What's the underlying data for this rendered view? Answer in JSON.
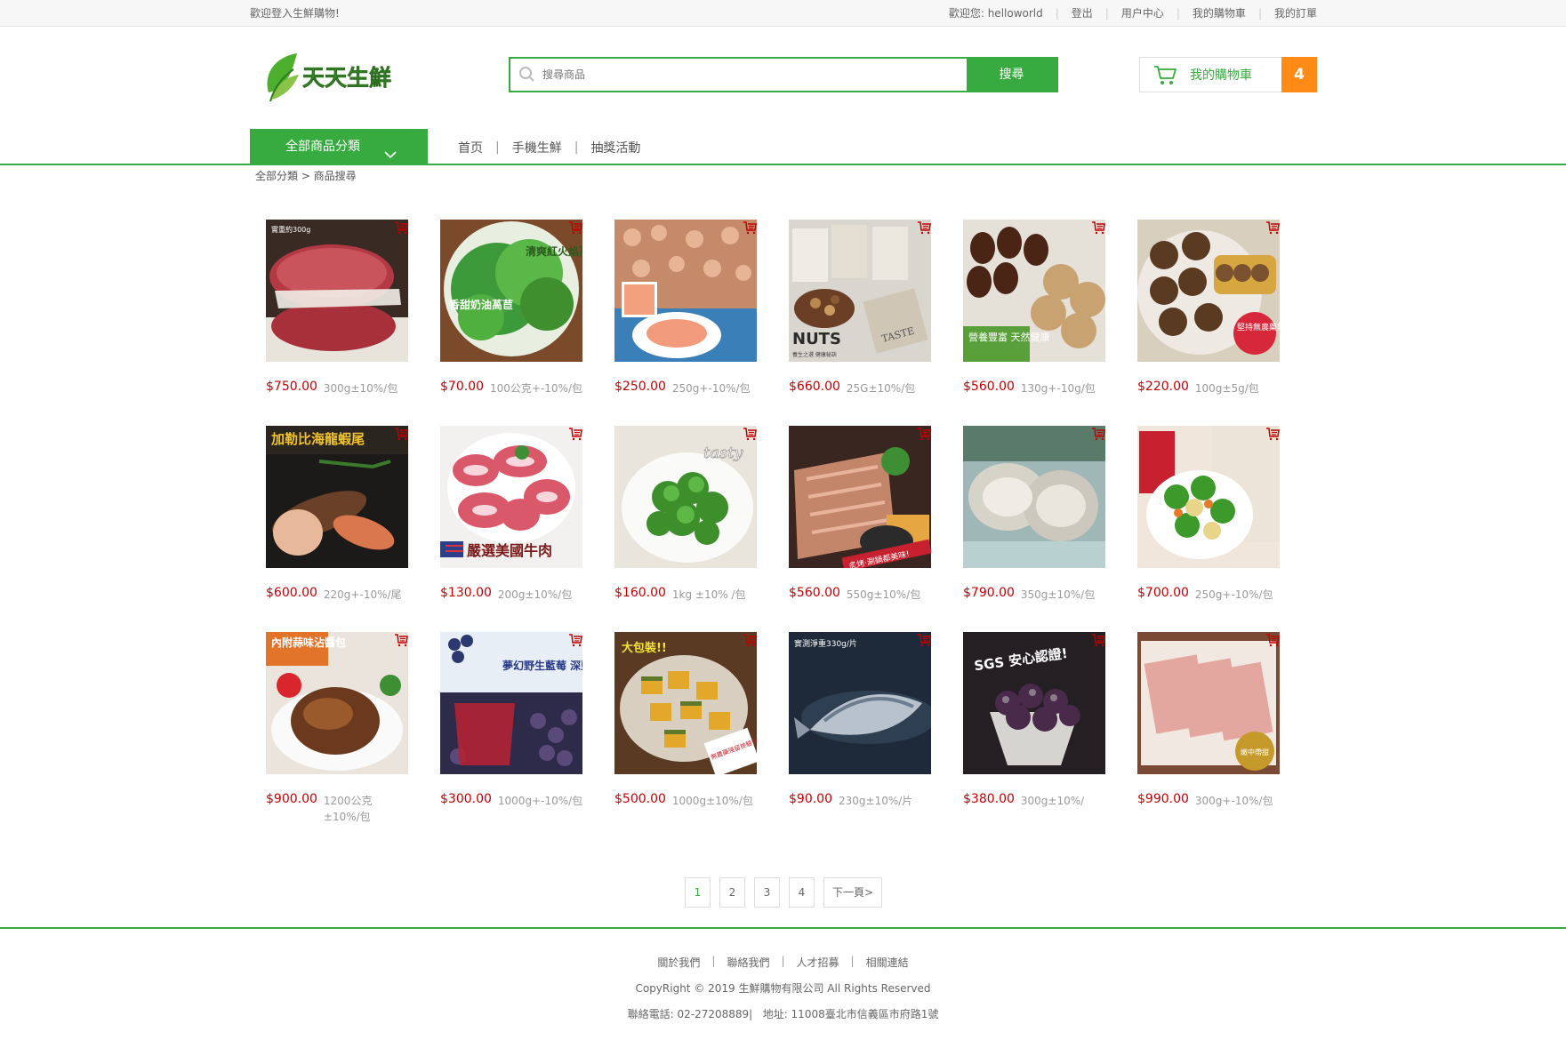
{
  "topbar": {
    "welcome": "歡迎登入生鮮購物!",
    "greeting": "歡迎您: helloworld",
    "logout": "登出",
    "user_center": "用户中心",
    "my_cart": "我的購物車",
    "my_orders": "我的訂單"
  },
  "header": {
    "logo_text": "天天生鮮",
    "search_placeholder": "搜尋商品",
    "search_button": "搜尋",
    "cart_label": "我的購物車",
    "cart_count": "4"
  },
  "nav": {
    "all_categories": "全部商品分類",
    "home": "首页",
    "mobile": "手機生鮮",
    "lottery": "抽獎活動"
  },
  "breadcrumb": "全部分類 > 商品搜尋",
  "products": [
    {
      "price": "$750.00",
      "unit": "300g±10%/包",
      "name": "beef-patty"
    },
    {
      "price": "$70.00",
      "unit": "100公克+-10%/包",
      "name": "lettuce"
    },
    {
      "price": "$250.00",
      "unit": "250g+-10%/包",
      "name": "shrimp"
    },
    {
      "price": "$660.00",
      "unit": "25G±10%/包",
      "name": "nuts"
    },
    {
      "price": "$560.00",
      "unit": "130g+-10g/包",
      "name": "dried-figs"
    },
    {
      "price": "$220.00",
      "unit": "100g±5g/包",
      "name": "shiitake"
    },
    {
      "price": "$600.00",
      "unit": "220g+-10%/尾",
      "name": "lobster"
    },
    {
      "price": "$130.00",
      "unit": "200g±10%/包",
      "name": "beef-slices"
    },
    {
      "price": "$160.00",
      "unit": "1kg ±10% /包",
      "name": "broccoli"
    },
    {
      "price": "$560.00",
      "unit": "550g±10%/包",
      "name": "pork-belly"
    },
    {
      "price": "$790.00",
      "unit": "350g±10%/包",
      "name": "oysters"
    },
    {
      "price": "$700.00",
      "unit": "250g+-10%/包",
      "name": "mixed-veg"
    },
    {
      "price": "$900.00",
      "unit": "1200公克±10%/包",
      "name": "pork-knuckle"
    },
    {
      "price": "$300.00",
      "unit": "1000g+-10%/包",
      "name": "blueberries"
    },
    {
      "price": "$500.00",
      "unit": "1000g±10%/包",
      "name": "pumpkin"
    },
    {
      "price": "$90.00",
      "unit": "230g±10%/片",
      "name": "mackerel"
    },
    {
      "price": "$380.00",
      "unit": "300g±10%/",
      "name": "mulberries"
    },
    {
      "price": "$990.00",
      "unit": "300g+-10%/包",
      "name": "pork-slices"
    }
  ],
  "badges": {
    "beef_top": "實重約300g",
    "lettuce_a": "清爽紅火焰萵苣",
    "lettuce_b": "香甜奶油萵苣",
    "nuts": "NUTS",
    "nuts_sub": "養生之選 健康秘訣",
    "nuts_taste": "TASTE",
    "figs": "營養豐富 天然健康",
    "shiitake": "堅持無農藥無添加",
    "lobster": "加勒比海龍蝦尾",
    "beef": "嚴選美國牛肉",
    "broccoli": "tasty",
    "pork_belly": "炙烤·涮鍋都美味!",
    "knuckle": "內附蒜味沾醬包",
    "blueberry": "夢幻野生藍莓 深藍色神奇魅力",
    "pumpkin": "大包裝!!",
    "pumpkin_b": "無農藥殘留檢驗合格",
    "mackerel": "實測淨重330g/片",
    "mulberry": "SGS 安心認證!",
    "pork_slice": "嫩中帶甜"
  },
  "pagination": {
    "pages": [
      "1",
      "2",
      "3",
      "4"
    ],
    "next": "下一頁>"
  },
  "footer": {
    "about": "關於我們",
    "contact": "聯絡我們",
    "jobs": "人才招募",
    "links": "相關連結",
    "copyright": "CopyRight © 2019 生鮮購物有限公司 All Rights Reserved",
    "phone": "聯絡電話: 02-27208889|",
    "address": "地址: 11008臺北市信義區市府路1號"
  },
  "colors": {
    "accent_green": "#37ab40",
    "price_red": "#c40000",
    "cart_orange": "#fe8b15"
  }
}
